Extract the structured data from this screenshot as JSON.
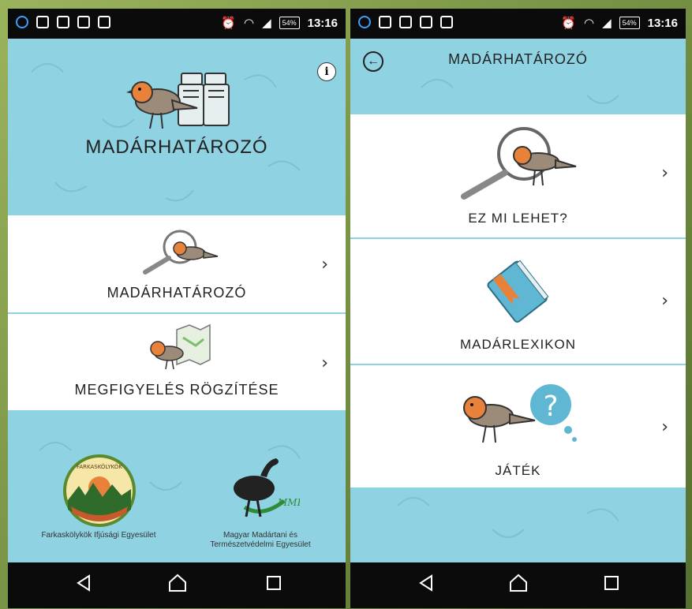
{
  "left_screen": {
    "status_time": "13:16",
    "battery": "54%",
    "app_title": "MADÁRHATÁROZÓ",
    "info_glyph": "i",
    "menu": [
      {
        "label": "MADÁRHATÁROZÓ",
        "icon": "magnifier-bird-icon"
      },
      {
        "label": "MEGFIGYELÉS RÖGZÍTÉSE",
        "icon": "bird-map-icon"
      }
    ],
    "orgs": [
      {
        "name": "Farkaskölykök Ifjúsági Egyesület",
        "badge_text": "FARKASKÖLYKÖK"
      },
      {
        "name": "Magyar Madártani és Természetvédelmi Egyesület",
        "badge_text": "MME"
      }
    ]
  },
  "right_screen": {
    "status_time": "13:16",
    "battery": "54%",
    "header_title": "MADÁRHATÁROZÓ",
    "menu": [
      {
        "label": "EZ MI LEHET?",
        "icon": "magnifier-bird-icon"
      },
      {
        "label": "MADÁRLEXIKON",
        "icon": "book-icon"
      },
      {
        "label": "JÁTÉK",
        "icon": "bird-question-icon"
      }
    ]
  },
  "chevron": "›",
  "colors": {
    "sky": "#8fd3e3",
    "robin_breast": "#e8823a",
    "bird_body": "#9b8b78",
    "status_bar": "#0b0b0b"
  }
}
